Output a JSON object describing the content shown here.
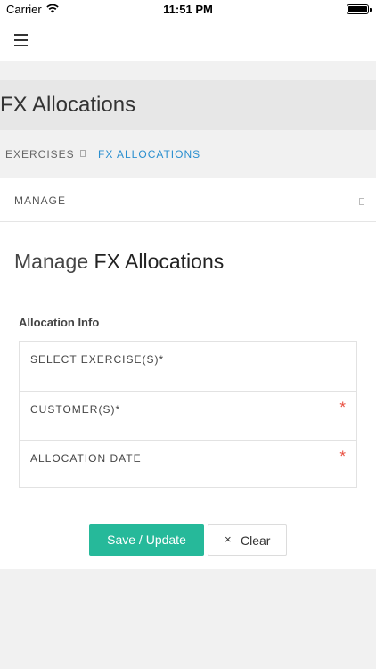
{
  "status_bar": {
    "carrier": "Carrier",
    "time": "11:51 PM"
  },
  "page": {
    "title": "FX Allocations"
  },
  "breadcrumb": {
    "items": [
      "EXERCISES",
      "FX ALLOCATIONS"
    ]
  },
  "panel": {
    "header_label": "MANAGE",
    "title_prefix": "Manage",
    "title_emphasis": "FX Allocations",
    "section_title": "Allocation Info",
    "fields": [
      {
        "label": "SELECT EXERCISE(S)*",
        "required_marker": ""
      },
      {
        "label": "CUSTOMER(S)*",
        "required_marker": "*"
      },
      {
        "label": "ALLOCATION DATE",
        "required_marker": "*"
      }
    ]
  },
  "actions": {
    "save_label": "Save / Update",
    "clear_label": "Clear",
    "clear_icon": "×"
  },
  "colors": {
    "accent": "#26b99a",
    "link": "#2a8fcf",
    "required": "#e84c3d"
  }
}
